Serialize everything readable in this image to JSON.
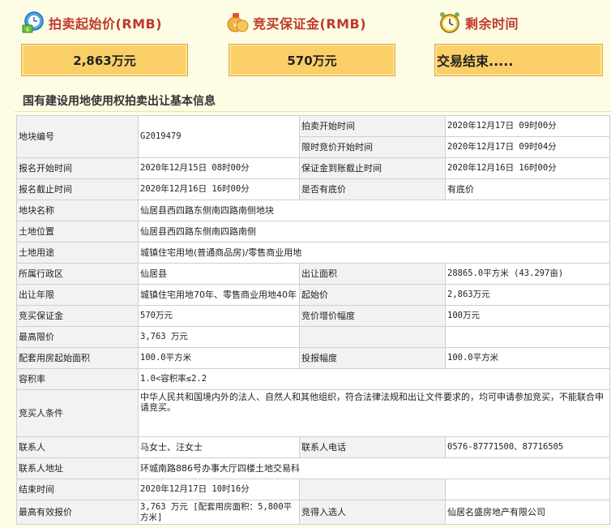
{
  "header": {
    "start_price_label": "拍卖起始价(RMB)",
    "deposit_label": "竞买保证金(RMB)",
    "time_label": "剩余时间"
  },
  "boxes": {
    "start_price": "2,863万元",
    "deposit": "570万元",
    "remaining": "交易结束....."
  },
  "section_title": "国有建设用地使用权拍卖出让基本信息",
  "rows": {
    "r1": {
      "l1": "地块编号",
      "v1": "G2019479",
      "l2": "拍卖开始时间",
      "v2": "2020年12月17日 09时00分"
    },
    "r2": {
      "l2": "限时竞价开始时间",
      "v2": "2020年12月17日 09时04分"
    },
    "r3": {
      "l1": "报名开始时间",
      "v1": "2020年12月15日 08时00分",
      "l2": "保证金到账截止时间",
      "v2": "2020年12月16日 16时00分"
    },
    "r4": {
      "l1": "报名截止时间",
      "v1": "2020年12月16日 16时00分",
      "l2": "是否有底价",
      "v2": "有底价"
    },
    "r5": {
      "l1": "地块名称",
      "v1": "仙居县西四路东侧南四路南侧地块"
    },
    "r6": {
      "l1": "土地位置",
      "v1": "仙居县西四路东侧南四路南侧"
    },
    "r7": {
      "l1": "土地用途",
      "v1": "城镇住宅用地(普通商品房)/零售商业用地"
    },
    "r8": {
      "l1": "所属行政区",
      "v1": "仙居县",
      "l2": "出让面积",
      "v2": "28865.0平方米 (43.297亩)"
    },
    "r9": {
      "l1": "出让年限",
      "v1": "城镇住宅用地70年、零售商业用地40年",
      "l2": "起始价",
      "v2": "2,863万元"
    },
    "r10": {
      "l1": "竞买保证金",
      "v1": "570万元",
      "l2": "竞价增价幅度",
      "v2": "100万元"
    },
    "r11": {
      "l1": "最高限价",
      "v1": "3,763 万元"
    },
    "r12": {
      "l1": "配套用房起始面积",
      "v1": "100.0平方米",
      "l2": "投报幅度",
      "v2": "100.0平方米"
    },
    "r13": {
      "l1": "容积率",
      "v1": "1.0<容积率≤2.2"
    },
    "r14": {
      "l1": "竞买人条件",
      "v1": "中华人民共和国境内外的法人、自然人和其他组织，符合法律法规和出让文件要求的，均可申请参加竞买，不能联合申请竞买。"
    },
    "r15": {
      "l1": "联系人",
      "v1": "马女士、汪女士",
      "l2": "联系人电话",
      "v2": "0576-87771500、87716505"
    },
    "r16": {
      "l1": "联系人地址",
      "v1": "环城南路886号办事大厅四楼土地交易科"
    },
    "r17": {
      "l1": "结束时间",
      "v1": "2020年12月17日 10时16分"
    },
    "r18": {
      "l1": "最高有效报价",
      "v1": "3,763 万元 [配套用房面积：5,800平方米]",
      "l2": "竞得入选人",
      "v2": "仙居名盛房地产有限公司"
    }
  },
  "colors": {
    "accent": "#c0392b",
    "box_fill": "#fbcf68",
    "page_bg": "#fdfde6"
  }
}
